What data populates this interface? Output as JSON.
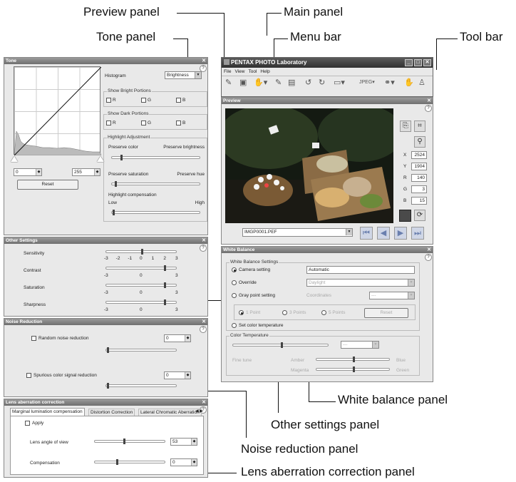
{
  "callouts": {
    "preview": "Preview panel",
    "main": "Main panel",
    "menubar": "Menu bar",
    "toolbar": "Tool bar",
    "tone": "Tone panel",
    "white_balance": "White balance panel",
    "other": "Other settings panel",
    "noise": "Noise reduction panel",
    "lens": "Lens aberration correction panel"
  },
  "app": {
    "title": "PENTAX PHOTO Laboratory",
    "menu": [
      "File",
      "View",
      "Tool",
      "Help"
    ]
  },
  "tone": {
    "title": "Tone",
    "histogram_label": "Histogram",
    "histogram_value": "Brightness",
    "bright_title": "Show Bright Portions",
    "dark_title": "Show Dark Portions",
    "r": "R",
    "g": "G",
    "b": "B",
    "highlight_title": "Highlight Adjustment",
    "preserve_color": "Preserve color",
    "preserve_brightness": "Preserve brightness",
    "preserve_saturation": "Preserve saturation",
    "preserve_hue": "Preserve hue",
    "highlight_comp": "Highlight compensation",
    "low": "Low",
    "high": "High",
    "min_value": "0",
    "max_value": "255",
    "reset": "Reset"
  },
  "other": {
    "title": "Other Settings",
    "sensitivity": "Sensitivity",
    "contrast": "Contrast",
    "saturation": "Saturation",
    "sharpness": "Sharpness",
    "ticks7": [
      "-3",
      "-2",
      "-1",
      "0",
      "1",
      "2",
      "3"
    ],
    "ticks3": [
      "-3",
      "0",
      "3"
    ]
  },
  "noise": {
    "title": "Noise Reduction",
    "random": "Random noise reduction",
    "random_value": "0",
    "spurious": "Spurious color signal reduction",
    "spurious_value": "0"
  },
  "lens": {
    "title": "Lens aberration correction",
    "tabs": [
      "Marginal lumination compensation",
      "Distortion Correction",
      "Lateral Chromatic Aberration"
    ],
    "apply": "Apply",
    "angle": "Lens angle of view",
    "angle_value": "53",
    "comp": "Compensation",
    "comp_value": "0"
  },
  "preview": {
    "title": "Preview",
    "file": "IMGP0001.PEF",
    "x_label": "X",
    "x": "2524",
    "y_label": "Y",
    "y": "1904",
    "r_label": "R",
    "r": "140",
    "g_label": "G",
    "g": "3",
    "b_label": "B",
    "b": "15"
  },
  "wb": {
    "title": "White Balance",
    "settings_title": "White Balance Settings",
    "camera": "Camera setting",
    "camera_value": "Automatic",
    "override": "Override",
    "override_value": "Daylight",
    "gray": "Gray point setting",
    "coordinates": "Coordinates",
    "coord_value": "---",
    "p1": "1 Point",
    "p3": "3 Points",
    "p5": "5 Points",
    "reset": "Reset",
    "set_temp": "Set color temperature",
    "temp_title": "Color Temperature",
    "temp_value": "---",
    "fine": "Fine tune",
    "amber": "Amber",
    "blue": "Blue",
    "magenta": "Magenta",
    "green": "Green"
  }
}
